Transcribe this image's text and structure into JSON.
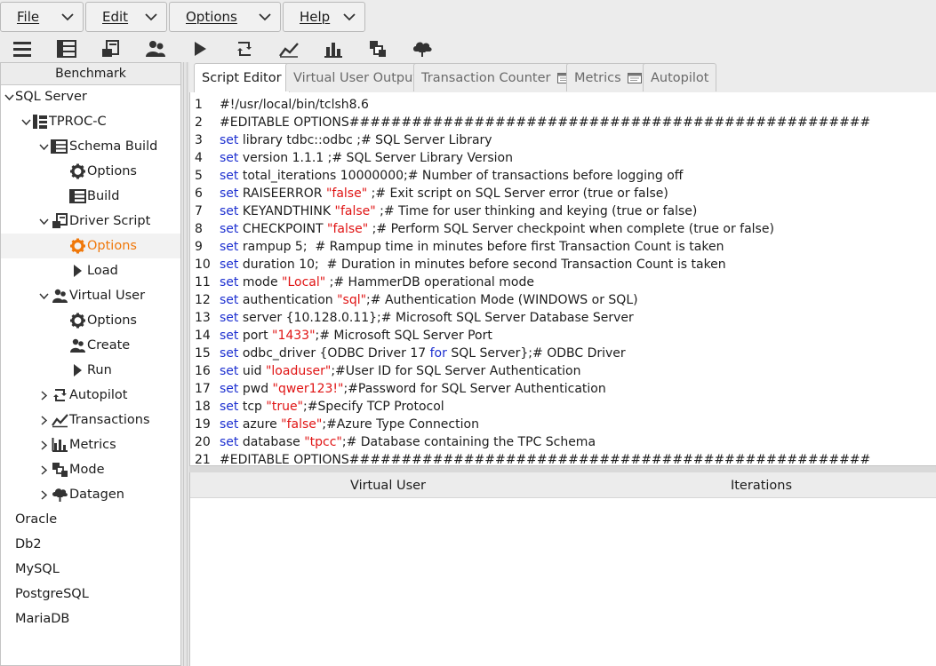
{
  "menu": {
    "file": "File",
    "edit": "Edit",
    "options": "Options",
    "help": "Help"
  },
  "toolbar": {
    "icons": [
      "menu-icon",
      "benchmark-icon",
      "driver-script-icon",
      "virtual-users-icon",
      "run-icon",
      "autopilot-icon",
      "transactions-icon",
      "metrics-icon",
      "mode-icon",
      "datagen-icon"
    ]
  },
  "tree": {
    "header": "Benchmark",
    "sql_server": "SQL Server",
    "tproc_c": "TPROC-C",
    "schema_build": "Schema Build",
    "schema_options": "Options",
    "schema_build_item": "Build",
    "driver_script": "Driver Script",
    "driver_options": "Options",
    "driver_load": "Load",
    "virtual_user": "Virtual User",
    "vu_options": "Options",
    "vu_create": "Create",
    "vu_run": "Run",
    "autopilot": "Autopilot",
    "transactions": "Transactions",
    "metrics": "Metrics",
    "mode": "Mode",
    "datagen": "Datagen",
    "oracle": "Oracle",
    "db2": "Db2",
    "mysql": "MySQL",
    "postgresql": "PostgreSQL",
    "mariadb": "MariaDB"
  },
  "tabs": {
    "script_editor": "Script Editor",
    "virtual_user_output": "Virtual User Output",
    "transaction_counter": "Transaction Counter",
    "metrics": "Metrics",
    "autopilot": "Autopilot"
  },
  "editor": {
    "lines": [
      [
        {
          "t": "#!/usr/local/bin/tclsh8.6",
          "c": ""
        }
      ],
      [
        {
          "t": "#EDITABLE OPTIONS##################################################",
          "c": ""
        }
      ],
      [
        {
          "t": "set",
          "c": "k"
        },
        {
          "t": " library tdbc::odbc ;# SQL Server Library",
          "c": ""
        }
      ],
      [
        {
          "t": "set",
          "c": "k"
        },
        {
          "t": " version 1.1.1 ;# SQL Server Library Version",
          "c": ""
        }
      ],
      [
        {
          "t": "set",
          "c": "k"
        },
        {
          "t": " total_iterations 10000000;# Number of transactions before logging off",
          "c": ""
        }
      ],
      [
        {
          "t": "set",
          "c": "k"
        },
        {
          "t": " RAISEERROR ",
          "c": ""
        },
        {
          "t": "\"false\"",
          "c": "s"
        },
        {
          "t": " ;# Exit script on SQL Server error (true or false)",
          "c": ""
        }
      ],
      [
        {
          "t": "set",
          "c": "k"
        },
        {
          "t": " KEYANDTHINK ",
          "c": ""
        },
        {
          "t": "\"false\"",
          "c": "s"
        },
        {
          "t": " ;# Time for user thinking and keying (true or false)",
          "c": ""
        }
      ],
      [
        {
          "t": "set",
          "c": "k"
        },
        {
          "t": " CHECKPOINT ",
          "c": ""
        },
        {
          "t": "\"false\"",
          "c": "s"
        },
        {
          "t": " ;# Perform SQL Server checkpoint when complete (true or false)",
          "c": ""
        }
      ],
      [
        {
          "t": "set",
          "c": "k"
        },
        {
          "t": " rampup 5;  # Rampup time in minutes before first Transaction Count is taken",
          "c": ""
        }
      ],
      [
        {
          "t": "set",
          "c": "k"
        },
        {
          "t": " duration 10;  # Duration in minutes before second Transaction Count is taken",
          "c": ""
        }
      ],
      [
        {
          "t": "set",
          "c": "k"
        },
        {
          "t": " mode ",
          "c": ""
        },
        {
          "t": "\"Local\"",
          "c": "s"
        },
        {
          "t": " ;# HammerDB operational mode",
          "c": ""
        }
      ],
      [
        {
          "t": "set",
          "c": "k"
        },
        {
          "t": " authentication ",
          "c": ""
        },
        {
          "t": "\"sql\"",
          "c": "s"
        },
        {
          "t": ";# Authentication Mode (WINDOWS or SQL)",
          "c": ""
        }
      ],
      [
        {
          "t": "set",
          "c": "k"
        },
        {
          "t": " server {10.128.0.11};# Microsoft SQL Server Database Server",
          "c": ""
        }
      ],
      [
        {
          "t": "set",
          "c": "k"
        },
        {
          "t": " port ",
          "c": ""
        },
        {
          "t": "\"1433\"",
          "c": "s"
        },
        {
          "t": ";# Microsoft SQL Server Port",
          "c": ""
        }
      ],
      [
        {
          "t": "set",
          "c": "k"
        },
        {
          "t": " odbc_driver {ODBC Driver 17 ",
          "c": ""
        },
        {
          "t": "for",
          "c": "k"
        },
        {
          "t": " SQL Server};# ODBC Driver",
          "c": ""
        }
      ],
      [
        {
          "t": "set",
          "c": "k"
        },
        {
          "t": " uid ",
          "c": ""
        },
        {
          "t": "\"loaduser\"",
          "c": "s"
        },
        {
          "t": ";#User ID for SQL Server Authentication",
          "c": ""
        }
      ],
      [
        {
          "t": "set",
          "c": "k"
        },
        {
          "t": " pwd ",
          "c": ""
        },
        {
          "t": "\"qwer123!\"",
          "c": "s"
        },
        {
          "t": ";#Password for SQL Server Authentication",
          "c": ""
        }
      ],
      [
        {
          "t": "set",
          "c": "k"
        },
        {
          "t": " tcp ",
          "c": ""
        },
        {
          "t": "\"true\"",
          "c": "s"
        },
        {
          "t": ";#Specify TCP Protocol",
          "c": ""
        }
      ],
      [
        {
          "t": "set",
          "c": "k"
        },
        {
          "t": " azure ",
          "c": ""
        },
        {
          "t": "\"false\"",
          "c": "s"
        },
        {
          "t": ";#Azure Type Connection",
          "c": ""
        }
      ],
      [
        {
          "t": "set",
          "c": "k"
        },
        {
          "t": " database ",
          "c": ""
        },
        {
          "t": "\"tpcc\"",
          "c": "s"
        },
        {
          "t": ";# Database containing the TPC Schema",
          "c": ""
        }
      ],
      [
        {
          "t": "#EDITABLE OPTIONS##################################################",
          "c": ""
        }
      ]
    ]
  },
  "vu_table": {
    "col_virtual_user": "Virtual User",
    "col_iterations": "Iterations"
  },
  "colors": {
    "selected": "#f0780a",
    "keyword": "#1c2fd0",
    "string": "#e01414"
  }
}
